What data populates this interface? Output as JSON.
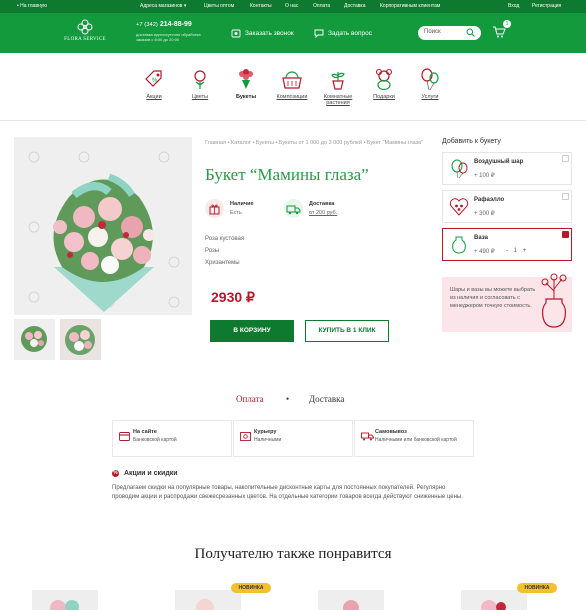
{
  "topbar": {
    "home_link": "• На главную",
    "stores_dropdown": "Адреса магазинов",
    "wholesale": "Цветы оптом",
    "contacts": "Контакты",
    "about": "О нас",
    "payment": "Оплата",
    "delivery": "Доставка",
    "corporate": "Корпоративным клиентам",
    "login": "Вход",
    "register": "Регистрация"
  },
  "header": {
    "logo_text": "FLORA SERVICE",
    "phone_code": "+7 (342)",
    "phone_number": "214-88-99",
    "phone_note": "доставка круглосуточно обработка заказов с 8:00 до 20:00",
    "callback": "Заказать звонок",
    "ask": "Задать вопрос",
    "search_placeholder": "Поиск",
    "cart_count": "1"
  },
  "categories": [
    {
      "label": "Акции",
      "icon": "tag-icon"
    },
    {
      "label": "Цветы",
      "icon": "flower-icon"
    },
    {
      "label": "Букеты",
      "icon": "bouquet-icon",
      "active": true
    },
    {
      "label": "Композиции",
      "icon": "basket-icon"
    },
    {
      "label": "Комнатные растения",
      "icon": "potted-plant-icon"
    },
    {
      "label": "Подарки",
      "icon": "teddy-bear-icon"
    },
    {
      "label": "Услуги",
      "icon": "balloons-icon"
    }
  ],
  "product": {
    "breadcrumbs": "Главная • Каталог • Букеты • Букеты от 1 000 до 3 000 рублей • Букет \"Мамины глаза\"",
    "title": "Букет “Мамины глаза”",
    "availability_label": "Наличие",
    "availability_value": "Есть",
    "delivery_label": "Доставка",
    "delivery_value": "от 200 руб.",
    "composition": [
      "Роза кустовая",
      "Розы",
      "Хризантемы"
    ],
    "price": "2930 ₽",
    "add_to_cart": "В КОРЗИНУ",
    "one_click": "КУПИТЬ В 1 КЛИК"
  },
  "addons": {
    "title": "Добавить к букету",
    "items": [
      {
        "name": "Воздушный шар",
        "price": "+ 100 ₽",
        "selected": false,
        "icon": "balloons-icon"
      },
      {
        "name": "Рафаэлло",
        "price": "+ 300 ₽",
        "selected": false,
        "icon": "candy-box-icon"
      },
      {
        "name": "Ваза",
        "price": "+ 490 ₽",
        "selected": true,
        "icon": "vase-icon",
        "qty": "1",
        "minus": "-",
        "plus": "+"
      }
    ],
    "promo_text": "Шары и вазы вы можете выбрать из наличия и согласовать с менеджером точную стоимость."
  },
  "tabs": {
    "payment": "Оплата",
    "separator": "•",
    "delivery": "Доставка"
  },
  "payment_methods": [
    {
      "title": "На сайте",
      "desc": "Банковской картой",
      "icon": "card-icon"
    },
    {
      "title": "Курьеру",
      "desc": "Наличными",
      "icon": "cash-icon"
    },
    {
      "title": "Самовывоз",
      "desc": "Наличными или банковской картой",
      "icon": "truck-icon"
    }
  ],
  "sale": {
    "heading": "Акции и скидки",
    "icon_glyph": "%",
    "text": "Предлагаем скидки на популярные товары, накопительные дисконтные карты для постоянных покупателей. Регулярно проводим акции и распродажи свежесрезанных цветов. На отдельные категории товаров всегда действуют сниженные цены."
  },
  "recommend": {
    "title": "Получателю также понравится",
    "badge": "НОВИНКА"
  },
  "colors": {
    "green_dark": "#0d7a2f",
    "green": "#129a3d",
    "title_green": "#2a9a47",
    "red": "#b5182a",
    "badge_yellow": "#f2c12e",
    "promo_pink": "#fbe5e8"
  }
}
